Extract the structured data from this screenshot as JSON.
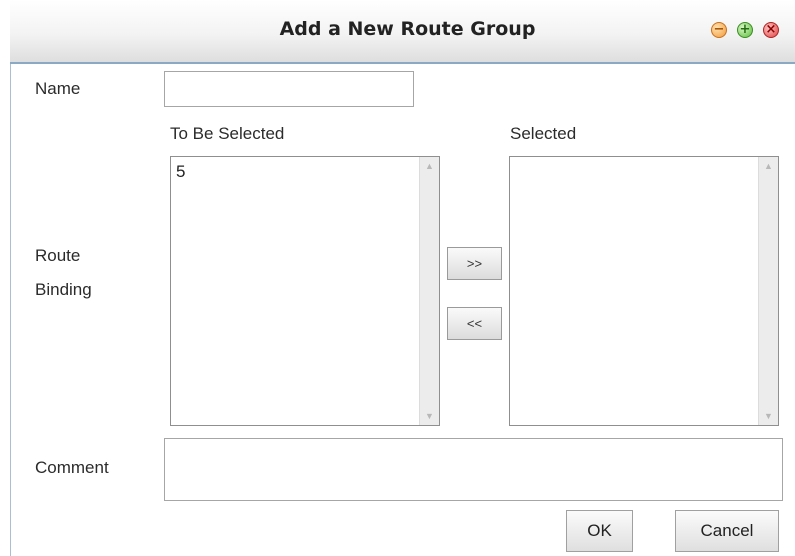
{
  "window": {
    "title": "Add a New Route Group",
    "controls": [
      {
        "name": "minimize",
        "icon": "minimize-icon",
        "glyph": "−"
      },
      {
        "name": "maximize",
        "icon": "maximize-icon",
        "glyph": "+"
      },
      {
        "name": "close",
        "icon": "close-icon",
        "glyph": "×"
      }
    ]
  },
  "form": {
    "name_label": "Name",
    "name_value": "",
    "route_binding_label_line1": "Route",
    "route_binding_label_line2": "Binding",
    "to_be_selected_label": "To Be Selected",
    "to_be_selected_items": [
      "5"
    ],
    "selected_label": "Selected",
    "selected_items": [],
    "add_button_label": ">>",
    "remove_button_label": "<<",
    "comment_label": "Comment",
    "comment_value": ""
  },
  "actions": {
    "ok_label": "OK",
    "cancel_label": "Cancel"
  },
  "colors": {
    "title_border": "#8aaac4",
    "minimize": "#f29a3a",
    "maximize": "#5bbd3c",
    "close": "#e04040"
  }
}
